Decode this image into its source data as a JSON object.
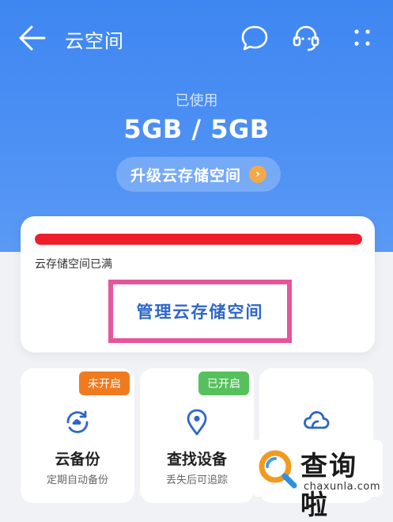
{
  "header": {
    "title": "云空间"
  },
  "storage": {
    "used_label": "已使用",
    "used_value": "5GB / 5GB",
    "upgrade_label": "升级云存储空间",
    "usage_fraction": 1.0,
    "bar_color": "#f01e2a",
    "status_text": "云存储空间已满",
    "manage_label": "管理云存储空间"
  },
  "tiles": [
    {
      "badge": "未开启",
      "badge_color": "#f07a1f",
      "title": "云备份",
      "subtitle": "定期自动备份",
      "icon": "cloud-sync-icon"
    },
    {
      "badge": "已开启",
      "badge_color": "#56c15c",
      "title": "查找设备",
      "subtitle": "丢失后可追踪",
      "icon": "location-pin-icon"
    },
    {
      "badge": "",
      "title": "",
      "subtitle": "",
      "icon": "cloud-icon"
    }
  ],
  "watermark": {
    "text": "查询啦",
    "url": "chaxunla.com"
  },
  "colors": {
    "accent": "#3e86f1",
    "highlight_border": "#e7559b",
    "manage_text": "#2d66c9"
  }
}
